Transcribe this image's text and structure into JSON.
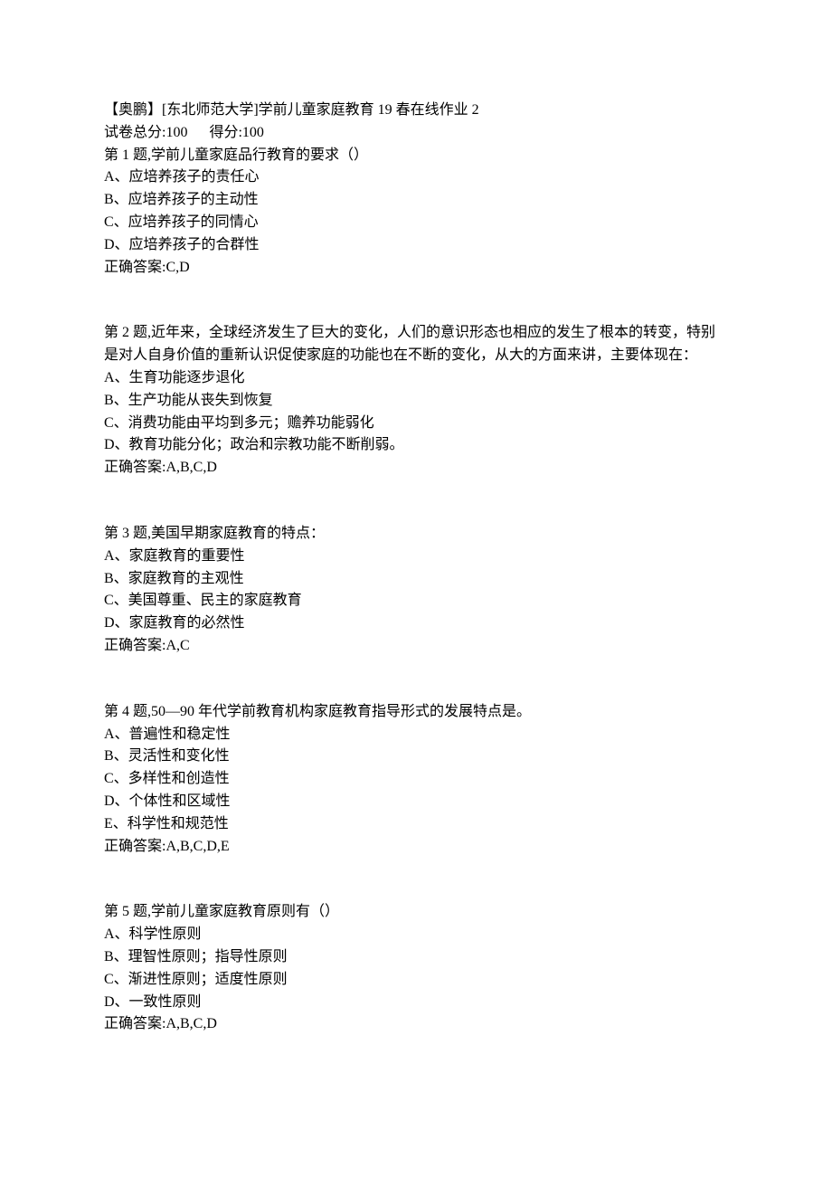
{
  "header": {
    "title": "【奥鹏】[东北师范大学]学前儿童家庭教育 19 春在线作业 2",
    "total_label": "试卷总分:100",
    "score_label": "得分:100"
  },
  "questions": [
    {
      "prompt": "第 1 题,学前儿童家庭品行教育的要求（）",
      "options": [
        "A、应培养孩子的责任心",
        "B、应培养孩子的主动性",
        "C、应培养孩子的同情心",
        "D、应培养孩子的合群性"
      ],
      "answer": "正确答案:C,D"
    },
    {
      "prompt": "第 2 题,近年来，全球经济发生了巨大的变化，人们的意识形态也相应的发生了根本的转变，特别是对人自身价值的重新认识促使家庭的功能也在不断的变化，从大的方面来讲，主要体现在：",
      "options": [
        "A、生育功能逐步退化",
        "B、生产功能从丧失到恢复",
        "C、消费功能由平均到多元；赡养功能弱化",
        "D、教育功能分化；政治和宗教功能不断削弱。"
      ],
      "answer": "正确答案:A,B,C,D"
    },
    {
      "prompt": "第 3 题,美国早期家庭教育的特点：",
      "options": [
        "A、家庭教育的重要性",
        "B、家庭教育的主观性",
        "C、美国尊重、民主的家庭教育",
        "D、家庭教育的必然性"
      ],
      "answer": "正确答案:A,C"
    },
    {
      "prompt": "第 4 题,50—90 年代学前教育机构家庭教育指导形式的发展特点是。",
      "options": [
        "A、普遍性和稳定性",
        "B、灵活性和变化性",
        "C、多样性和创造性",
        "D、个体性和区域性",
        "E、科学性和规范性"
      ],
      "answer": "正确答案:A,B,C,D,E"
    },
    {
      "prompt": "第 5 题,学前儿童家庭教育原则有（）",
      "options": [
        "A、科学性原则",
        "B、理智性原则；指导性原则",
        "C、渐进性原则；适度性原则",
        "D、一致性原则"
      ],
      "answer": "正确答案:A,B,C,D"
    }
  ]
}
